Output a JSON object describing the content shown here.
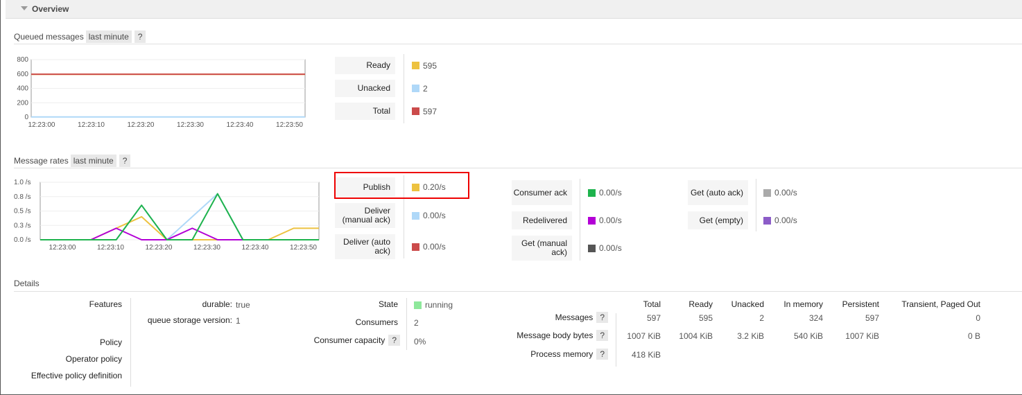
{
  "section": {
    "title": "Overview"
  },
  "queued": {
    "header": "Queued messages",
    "range": "last minute",
    "help": "?",
    "chart": {
      "y_ticks": [
        "800",
        "600",
        "400",
        "200",
        "0"
      ],
      "x_ticks": [
        "12:23:00",
        "12:23:10",
        "12:23:20",
        "12:23:30",
        "12:23:40",
        "12:23:50"
      ]
    },
    "legend": [
      {
        "label": "Ready",
        "value": "595",
        "color": "#edc240"
      },
      {
        "label": "Unacked",
        "value": "2",
        "color": "#afd8f8"
      },
      {
        "label": "Total",
        "value": "597",
        "color": "#cb4b4b"
      }
    ]
  },
  "rates": {
    "header": "Message rates",
    "range": "last minute",
    "help": "?",
    "chart": {
      "y_ticks": [
        "1.0 /s",
        "0.8 /s",
        "0.5 /s",
        "0.3 /s",
        "0.0 /s"
      ],
      "x_ticks": [
        "12:23:00",
        "12:23:10",
        "12:23:20",
        "12:23:30",
        "12:23:40",
        "12:23:50"
      ]
    },
    "legend": [
      {
        "label": "Publish",
        "value": "0.20/s",
        "color": "#edc240"
      },
      {
        "label": "Deliver (manual ack)",
        "value": "0.00/s",
        "color": "#afd8f8"
      },
      {
        "label": "Deliver (auto ack)",
        "value": "0.00/s",
        "color": "#cb4b4b"
      },
      {
        "label": "Consumer ack",
        "value": "0.00/s",
        "color": "#1eb34d"
      },
      {
        "label": "Redelivered",
        "value": "0.00/s",
        "color": "#b300d6"
      },
      {
        "label": "Get (manual ack)",
        "value": "0.00/s",
        "color": "#555555"
      },
      {
        "label": "Get (auto ack)",
        "value": "0.00/s",
        "color": "#aaaaaa"
      },
      {
        "label": "Get (empty)",
        "value": "0.00/s",
        "color": "#8c5cc8"
      }
    ]
  },
  "chart_data": [
    {
      "type": "line",
      "title": "Queued messages",
      "x": [
        "12:23:00",
        "12:23:10",
        "12:23:20",
        "12:23:30",
        "12:23:40",
        "12:23:50"
      ],
      "ylim": [
        0,
        800
      ],
      "series": [
        {
          "name": "Ready",
          "values": [
            595,
            595,
            595,
            595,
            595,
            595
          ]
        },
        {
          "name": "Unacked",
          "values": [
            2,
            2,
            2,
            2,
            2,
            2
          ]
        },
        {
          "name": "Total",
          "values": [
            597,
            597,
            597,
            597,
            597,
            597
          ]
        }
      ]
    },
    {
      "type": "line",
      "title": "Message rates",
      "x": [
        0,
        5,
        10,
        15,
        20,
        25,
        30,
        35,
        40,
        45,
        50,
        55
      ],
      "ylim": [
        0,
        1.0
      ],
      "series": [
        {
          "name": "Publish",
          "values": [
            0,
            0,
            0,
            0.2,
            0.4,
            0,
            0,
            0,
            0,
            0,
            0.2,
            0.2
          ]
        },
        {
          "name": "Deliver (manual ack)",
          "values": [
            0,
            0,
            0,
            0,
            0.6,
            0,
            0.4,
            0.8,
            0,
            0,
            0,
            0
          ]
        },
        {
          "name": "Consumer ack",
          "values": [
            0,
            0,
            0,
            0,
            0.6,
            0,
            0,
            0.8,
            0,
            0,
            0,
            0
          ]
        },
        {
          "name": "Redelivered",
          "values": [
            0,
            0,
            0,
            0.2,
            0,
            0,
            0.2,
            0,
            0,
            0,
            0,
            0
          ]
        }
      ]
    }
  ],
  "details": {
    "header": "Details",
    "features_label": "Features",
    "features": [
      {
        "key": "durable:",
        "value": "true"
      },
      {
        "key": "queue storage version:",
        "value": "1"
      }
    ],
    "policy_label": "Policy",
    "operator_policy_label": "Operator policy",
    "effective_policy_label": "Effective policy definition",
    "state_label": "State",
    "state_value": "running",
    "state_color": "#8ee89b",
    "consumers_label": "Consumers",
    "consumers_value": "2",
    "capacity_label": "Consumer capacity",
    "capacity_value": "0%",
    "table": {
      "columns": [
        "Total",
        "Ready",
        "Unacked",
        "In memory",
        "Persistent",
        "Transient, Paged Out"
      ],
      "rows": [
        {
          "label": "Messages",
          "values": [
            "597",
            "595",
            "2",
            "324",
            "597",
            "0"
          ]
        },
        {
          "label": "Message body bytes",
          "values": [
            "1007 KiB",
            "1004 KiB",
            "3.2 KiB",
            "540 KiB",
            "1007 KiB",
            "0 B"
          ]
        },
        {
          "label": "Process memory",
          "values": [
            "418 KiB",
            "",
            "",
            "",
            "",
            ""
          ]
        }
      ]
    }
  }
}
